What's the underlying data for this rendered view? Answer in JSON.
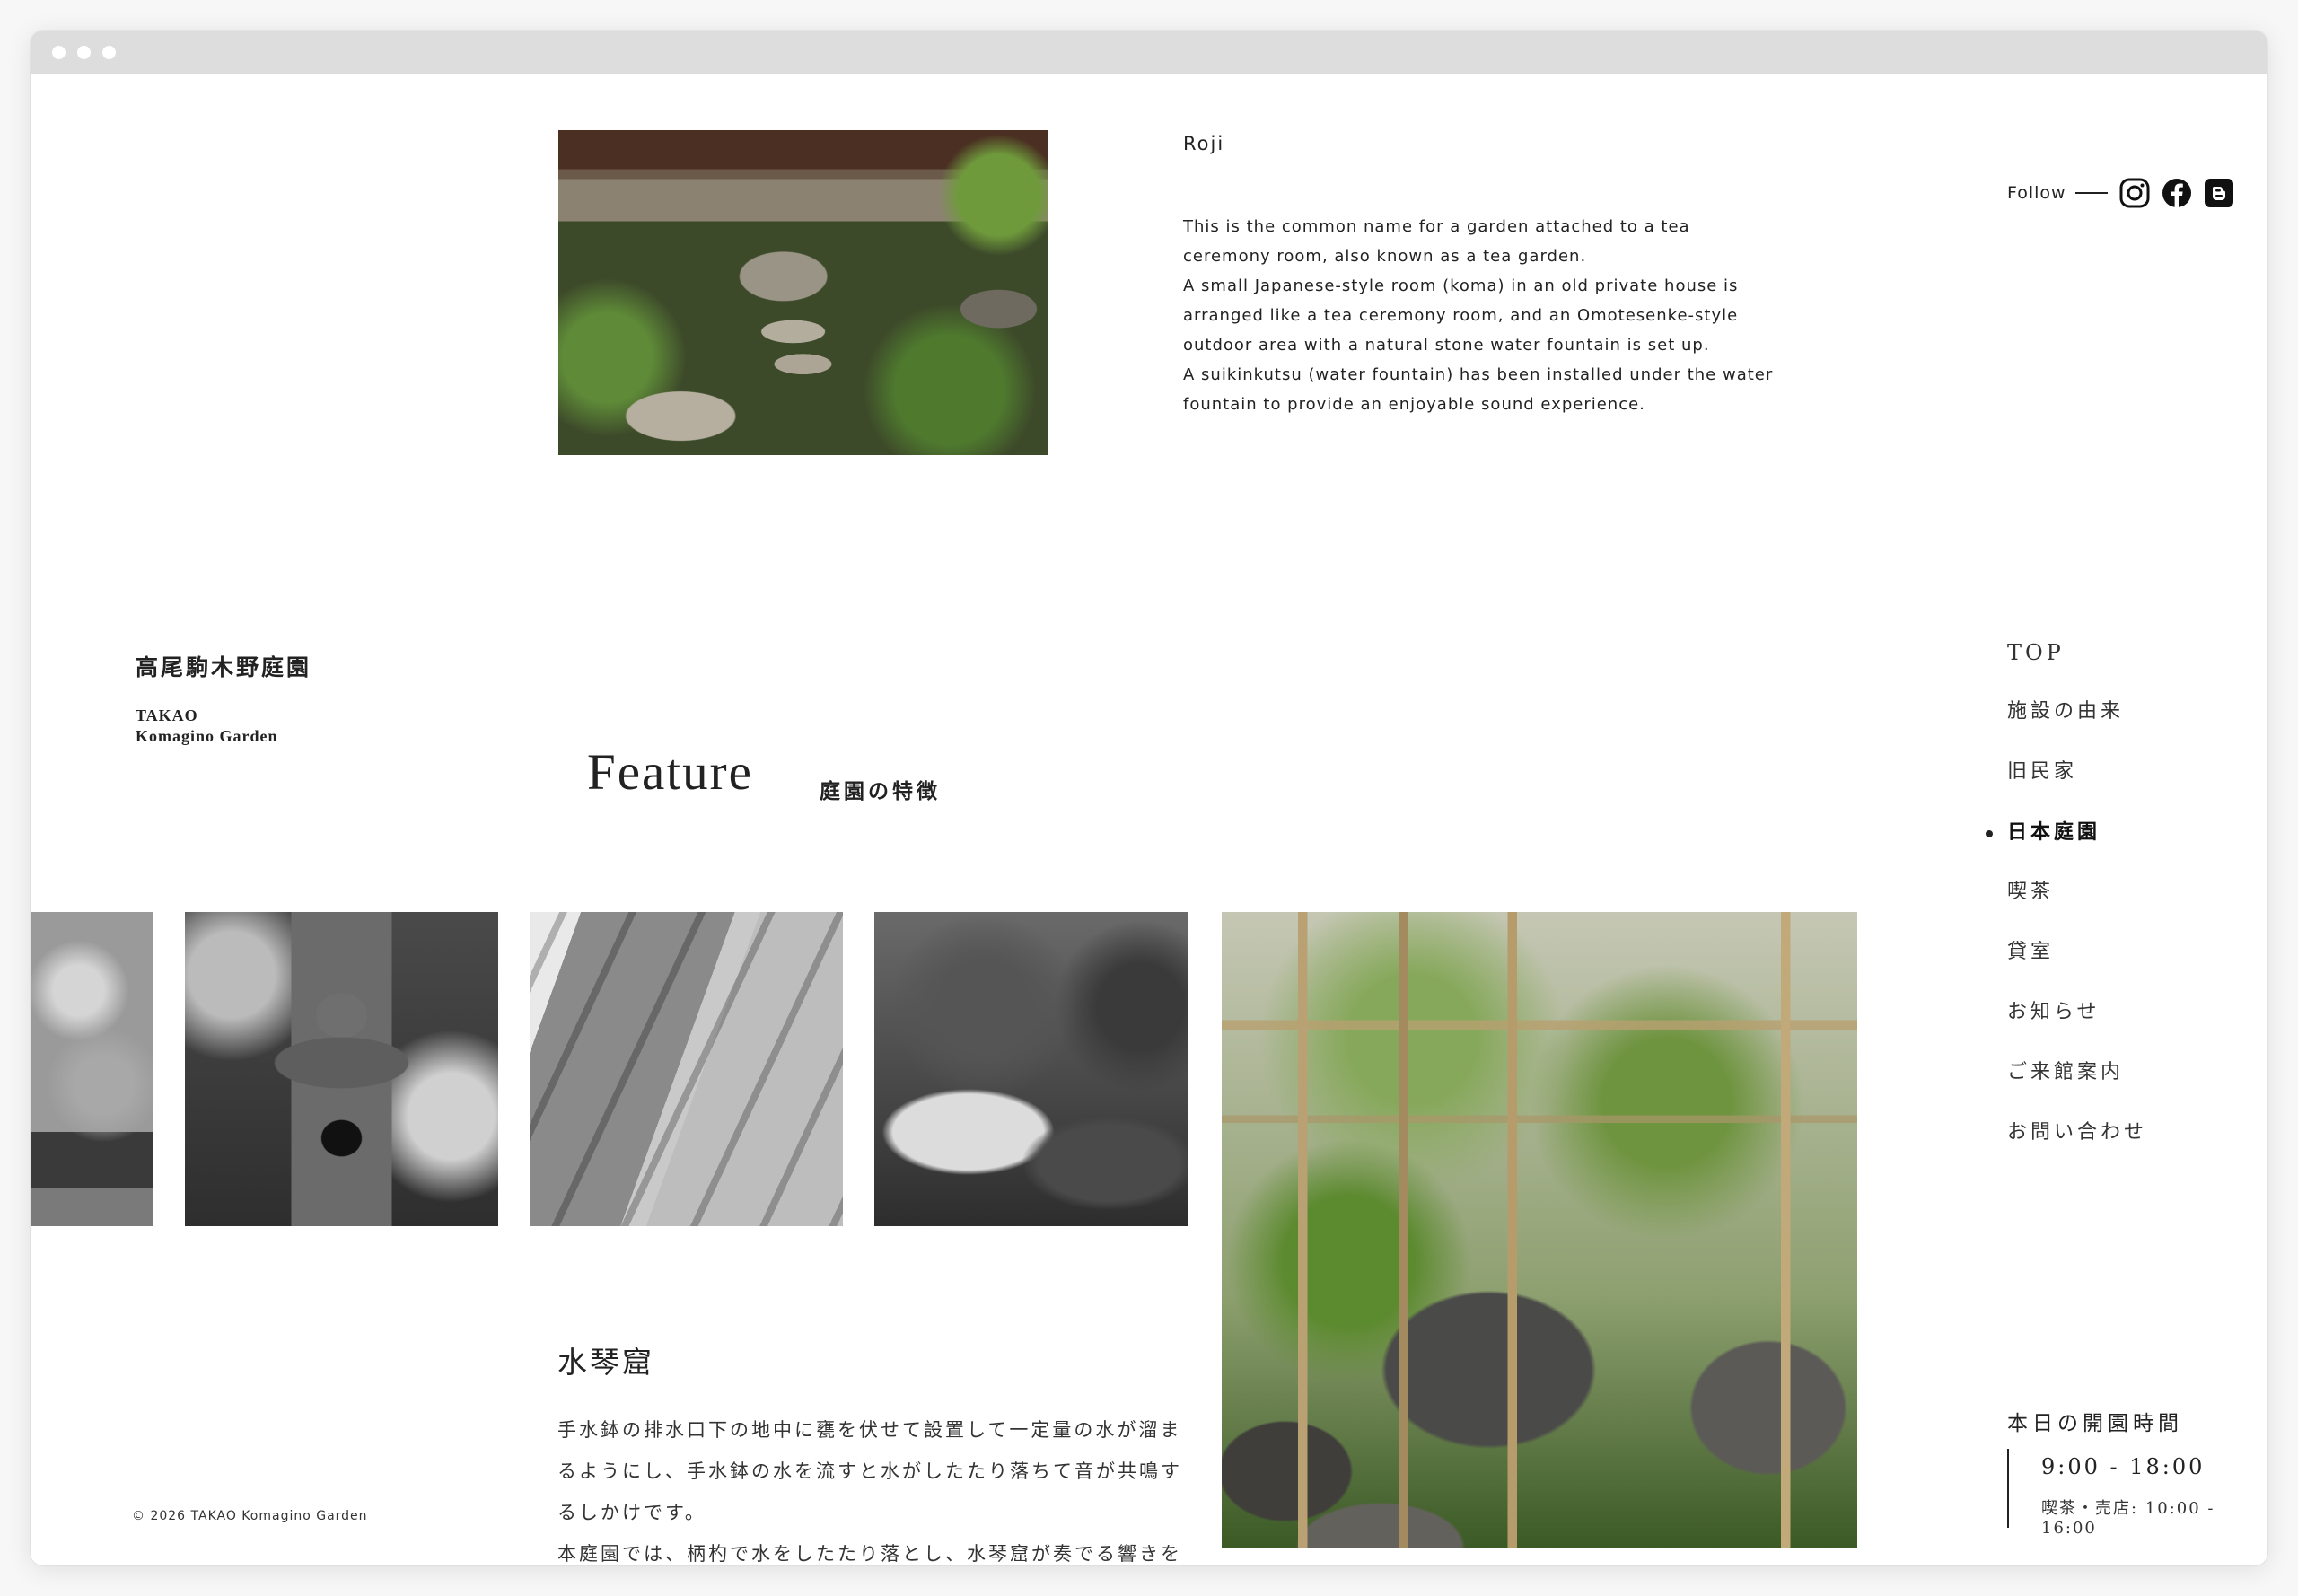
{
  "roji": {
    "title": "Roji",
    "paragraphs": [
      "This is the common name for a garden attached to a tea ceremony room, also known as a tea garden.",
      "A small Japanese-style room (koma) in an old private house is arranged like a tea ceremony room, and an Omotesenke-style outdoor area with a natural stone water fountain is set up.",
      "A suikinkutsu (water fountain) has been installed under the water fountain to provide an enjoyable sound experience."
    ]
  },
  "follow": {
    "label": "Follow",
    "icons": [
      "instagram-icon",
      "facebook-icon",
      "blogger-icon"
    ]
  },
  "logo": {
    "ja": "高尾駒木野庭園",
    "en_line1": "TAKAO",
    "en_line2": "Komagino Garden"
  },
  "feature": {
    "title": "Feature",
    "subtitle": "庭園の特徴"
  },
  "suikinkutsu": {
    "title": "水琴窟",
    "paragraphs": [
      "手水鉢の排水口下の地中に甕を伏せて設置して一定量の水が溜まるようにし、手水鉢の水を流すと水がしたたり落ちて音が共鳴するしかけです。",
      "本庭園では、柄杓で水をしたたり落とし、水琴窟が奏でる響きを楽しむことができます。"
    ]
  },
  "nav": {
    "items": [
      {
        "label": "TOP"
      },
      {
        "label": "施設の由来"
      },
      {
        "label": "旧民家"
      },
      {
        "label": "日本庭園",
        "active": true
      },
      {
        "label": "喫茶"
      },
      {
        "label": "貸室"
      },
      {
        "label": "お知らせ"
      },
      {
        "label": "ご来館案内"
      },
      {
        "label": "お問い合わせ"
      }
    ]
  },
  "hours": {
    "title": "本日の開園時間",
    "time": "9:00 - 18:00",
    "cafe": "喫茶・売店: 10:00 - 16:00"
  },
  "footer": {
    "copyright": "© 2026 TAKAO Komagino Garden"
  },
  "colors": {
    "text": "#222222",
    "background": "#ffffff",
    "titlebar": "#dddddd"
  }
}
